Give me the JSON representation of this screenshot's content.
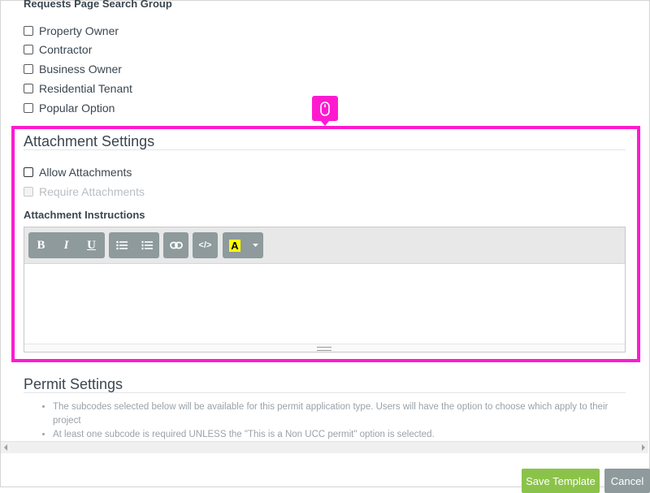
{
  "search_group": {
    "title": "Requests Page Search Group",
    "options": [
      {
        "label": "Property Owner",
        "checked": false
      },
      {
        "label": "Contractor",
        "checked": false
      },
      {
        "label": "Business Owner",
        "checked": false
      },
      {
        "label": "Residential Tenant",
        "checked": false
      },
      {
        "label": "Popular Option",
        "checked": false
      }
    ]
  },
  "cursor_indicator": {
    "icon": "mouse-icon",
    "color": "#ff1ad0"
  },
  "attachment_settings": {
    "title": "Attachment Settings",
    "allow_label": "Allow Attachments",
    "require_label": "Require Attachments",
    "instructions_label": "Attachment Instructions",
    "toolbar": {
      "bold": "B",
      "italic": "I",
      "underline": "U",
      "bullet_list_icon": "bullet-list-icon",
      "numbered_list_icon": "numbered-list-icon",
      "link_icon": "link-icon",
      "code": "</>",
      "highlight": "A"
    }
  },
  "permit_settings": {
    "title": "Permit Settings",
    "notes": [
      "The subcodes selected below will be available for this permit application type. Users will have the option to choose which apply to their project",
      "At least one subcode is required UNLESS the \"This is a Non UCC permit\" option is selected."
    ]
  },
  "footer": {
    "save_label": "Save Template",
    "cancel_label": "Cancel"
  },
  "colors": {
    "highlight": "#ff1ad0",
    "save": "#8bc34a",
    "toolbar_button": "#8e9a9c"
  }
}
